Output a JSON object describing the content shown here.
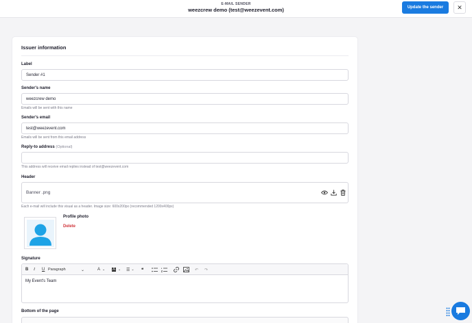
{
  "topbar": {
    "kicker": "E-MAIL SENDER",
    "title": "weezcrew demo (test@weezevent.com)",
    "update_label": "Update the sender",
    "close_label": "✕"
  },
  "card": {
    "title": "Issuer information",
    "label": {
      "label": "Label",
      "value": "Sender #1"
    },
    "sender_name": {
      "label": "Sender's name",
      "value": "weezcrew demo",
      "help": "Emails will be sent with this name"
    },
    "sender_email": {
      "label": "Sender's email",
      "value": "test@weezevent.com",
      "help": "Emails will be sent from this email address"
    },
    "reply_to": {
      "label": "Reply-to address",
      "optional": "(Optional)",
      "value": "",
      "help": "This address will receive email replies instead of test@weezevent.com"
    },
    "header": {
      "label": "Header",
      "file": "Banner .png",
      "help": "Each e-mail will include this visual as a header. Image size: 600x200px (recommended 1200x400px)",
      "icons": [
        "eye-icon",
        "download-icon",
        "trash-icon"
      ]
    },
    "profile": {
      "label": "Profile photo",
      "delete_label": "Delete"
    },
    "signature": {
      "label": "Signature",
      "paragraph_label": "Paragraph",
      "text": "My Event's Team"
    },
    "bottom": {
      "label": "Bottom of the page"
    }
  },
  "colors": {
    "accent": "#1a7be0",
    "danger": "#d0343a"
  }
}
